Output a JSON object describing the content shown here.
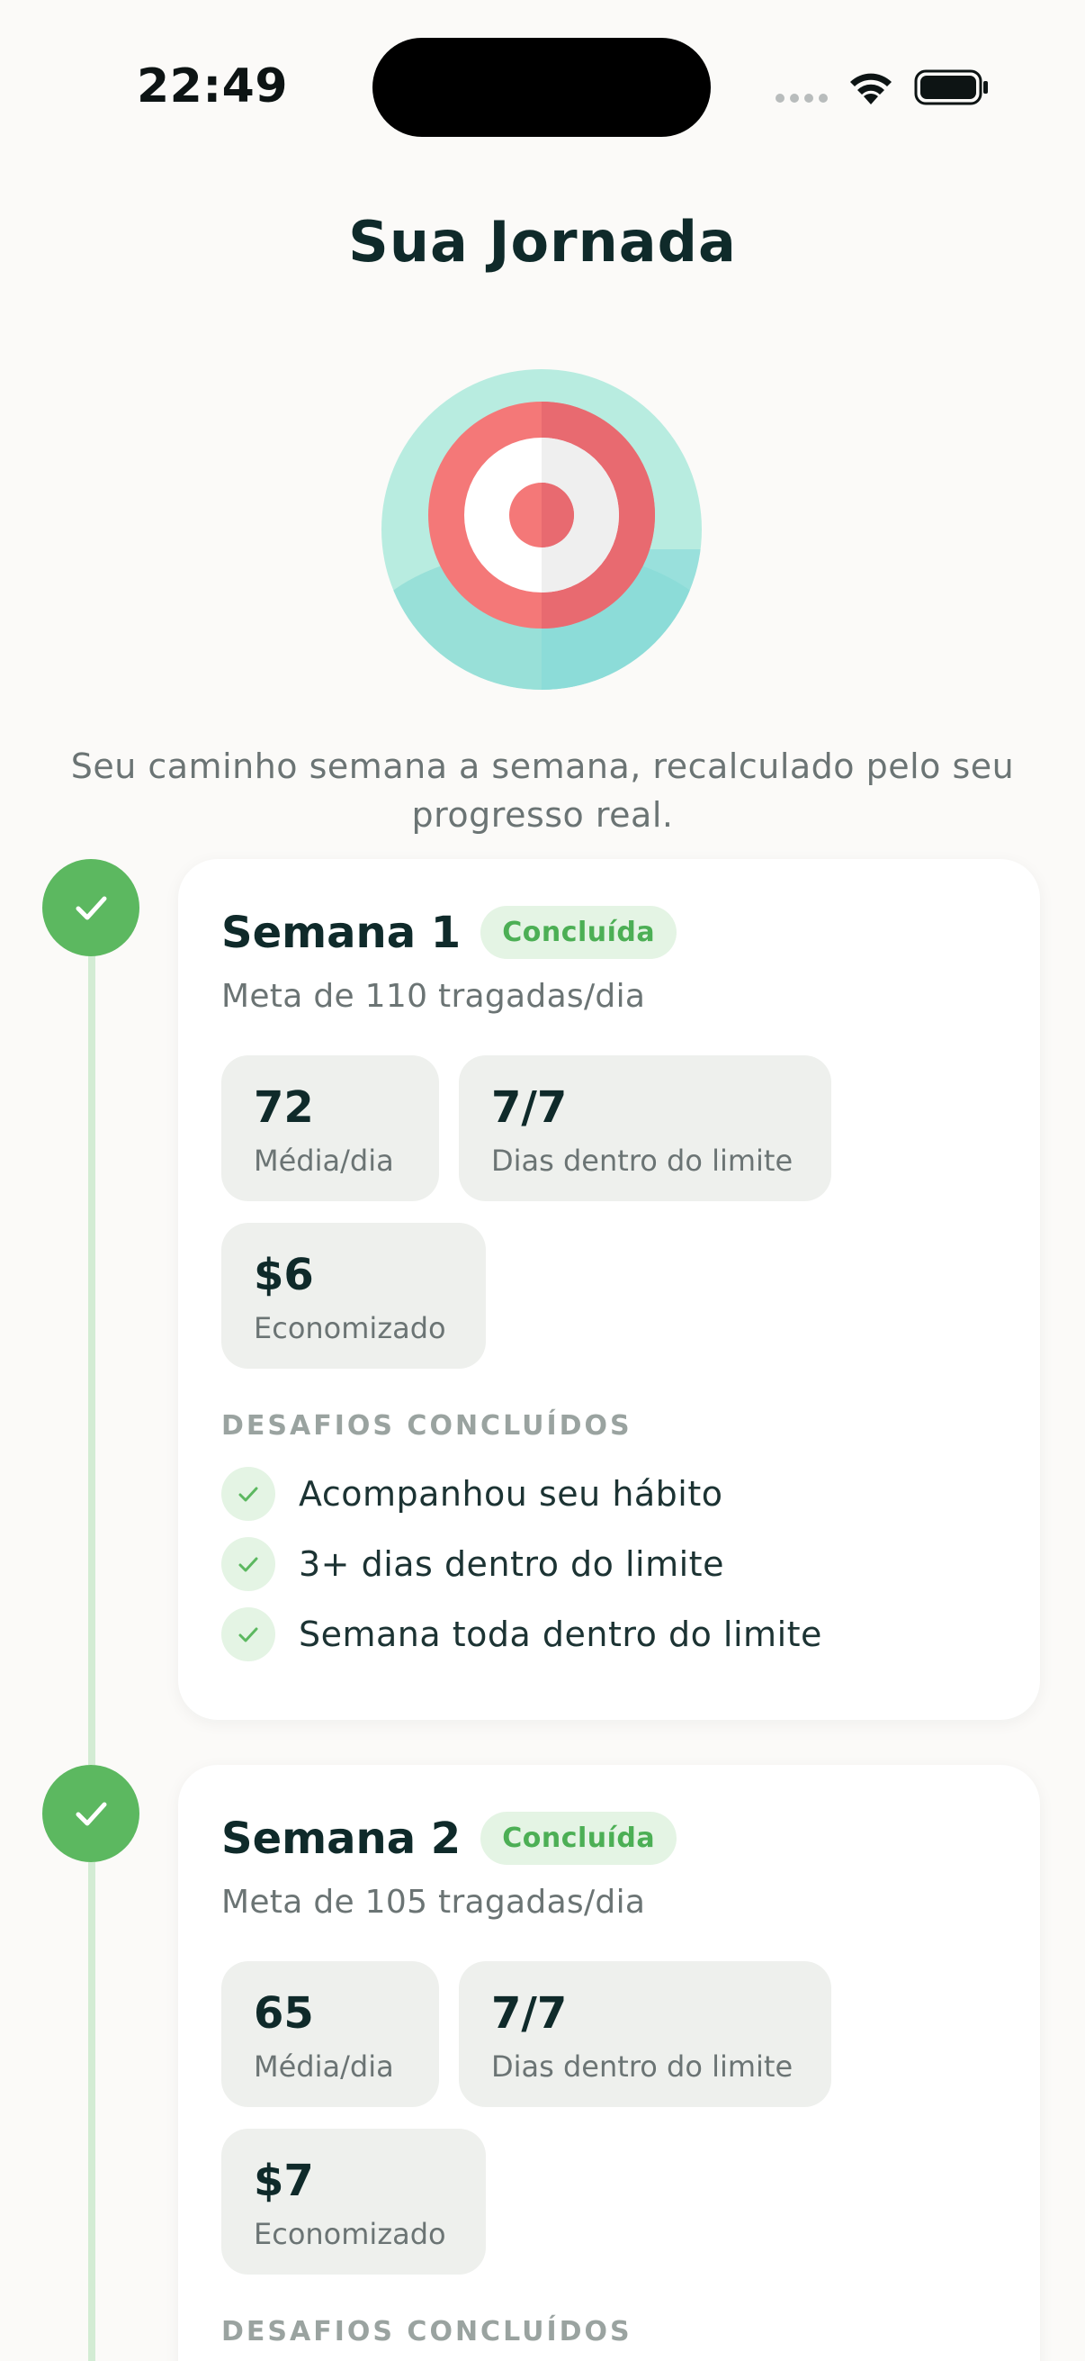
{
  "status_bar": {
    "time": "22:49"
  },
  "page": {
    "title": "Sua Jornada",
    "hero_icon": "target-icon",
    "subtitle": "Seu caminho semana a semana, recalculado pelo seu progresso real."
  },
  "colors": {
    "accent_green": "#5cb860",
    "badge_bg": "#e4f4e4",
    "timeline_line": "#d3ecd4",
    "target_red": "#f07070",
    "hero_bg": "#b8ece0"
  },
  "weeks": [
    {
      "title": "Semana 1",
      "status": "Concluída",
      "goal": "Meta de 110 tragadas/dia",
      "stats": [
        {
          "value": "72",
          "label": "Média/dia"
        },
        {
          "value": "7/7",
          "label": "Dias dentro do limite"
        },
        {
          "value": "$6",
          "label": "Economizado"
        }
      ],
      "challenges_header": "DESAFIOS CONCLUÍDOS",
      "challenges": [
        "Acompanhou seu hábito",
        "3+ dias dentro do limite",
        "Semana toda dentro do limite"
      ]
    },
    {
      "title": "Semana 2",
      "status": "Concluída",
      "goal": "Meta de 105 tragadas/dia",
      "stats": [
        {
          "value": "65",
          "label": "Média/dia"
        },
        {
          "value": "7/7",
          "label": "Dias dentro do limite"
        },
        {
          "value": "$7",
          "label": "Economizado"
        }
      ],
      "challenges_header": "DESAFIOS CONCLUÍDOS"
    }
  ]
}
